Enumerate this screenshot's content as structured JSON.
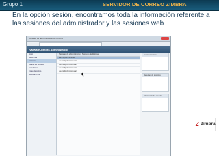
{
  "header": {
    "group": "Grupo 1",
    "title": "SERVIDOR DE CORREO ZIMBRA"
  },
  "intro": "En la opción sesión, encontramos toda la información referente a las sesiones del administrador  y las sesiones web",
  "screenshot": {
    "window_title": "Consola de administración de Zimbra",
    "url": "https://zimbra.example.com/zimbraAdmin",
    "app_title": "VMware Zimbra Administrator",
    "sidebar": [
      "Inicio",
      "Supervisar",
      "Sesiones",
      "Estado del servidor",
      "Estadísticas",
      "Colas de correo",
      "Notificaciones"
    ],
    "main_toolbar": "Sesiones de administración | Sesiones de Webmail",
    "rows": [
      "admin@dominio.local",
      "usuario1@dominio.local",
      "usuario2@dominio.local",
      "usuario3@dominio.local",
      "usuario4@dominio.local"
    ],
    "right_panels": [
      "Sesiones activas",
      "Resumen de sesiones",
      "Información del servidor"
    ]
  },
  "logo": {
    "mark": "Z",
    "text": "Zimbra"
  }
}
